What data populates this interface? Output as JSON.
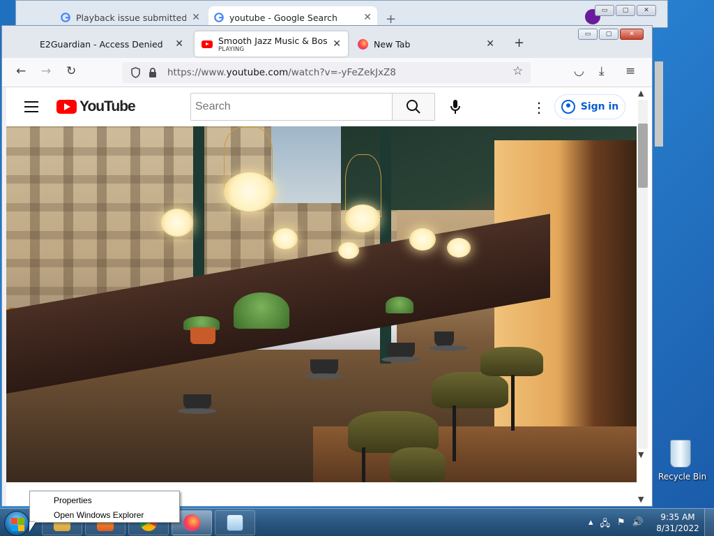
{
  "background_browser": {
    "tabs": [
      {
        "label": "Playback issue submitted - You",
        "close": "✕"
      },
      {
        "label": "youtube - Google Search",
        "close": "✕"
      }
    ],
    "new_tab": "+",
    "window_buttons": [
      "▭",
      "▢",
      "✕"
    ]
  },
  "firefox": {
    "tabs": [
      {
        "label": "E2Guardian - Access Denied",
        "close": "✕"
      },
      {
        "label": "Smooth Jazz Music & Bossa Nova",
        "status": "PLAYING",
        "close": "✕"
      },
      {
        "label": "New Tab",
        "close": "✕"
      }
    ],
    "new_tab": "+",
    "window_buttons": [
      "▭",
      "▢",
      "✕"
    ],
    "nav": {
      "back": "←",
      "forward": "→",
      "reload": "↻",
      "bookmark": "☆",
      "pocket": "◡",
      "downloads": "⤓",
      "menu": "≡"
    },
    "url": {
      "prefix": "https://www.",
      "host": "youtube.com",
      "path": "/watch?v=-yFeZekJxZ8"
    }
  },
  "youtube": {
    "logo_text": "YouTube",
    "search_placeholder": "Search",
    "kebab": "⋮",
    "sign_in": "Sign in"
  },
  "scrollbar": {
    "up": "▲",
    "down": "▼"
  },
  "desktop": {
    "recycle_bin": "Recycle Bin"
  },
  "context_menu": {
    "items": [
      "Properties",
      "Open Windows Explorer"
    ]
  },
  "taskbar": {
    "tray_icons": [
      "▴",
      "🖧",
      "⚑",
      "🔊"
    ],
    "time": "9:35 AM",
    "date": "8/31/2022"
  },
  "colors": {
    "youtube_red": "#ff0000",
    "signin_blue": "#065fd4",
    "taskbar": "#2a5680"
  }
}
